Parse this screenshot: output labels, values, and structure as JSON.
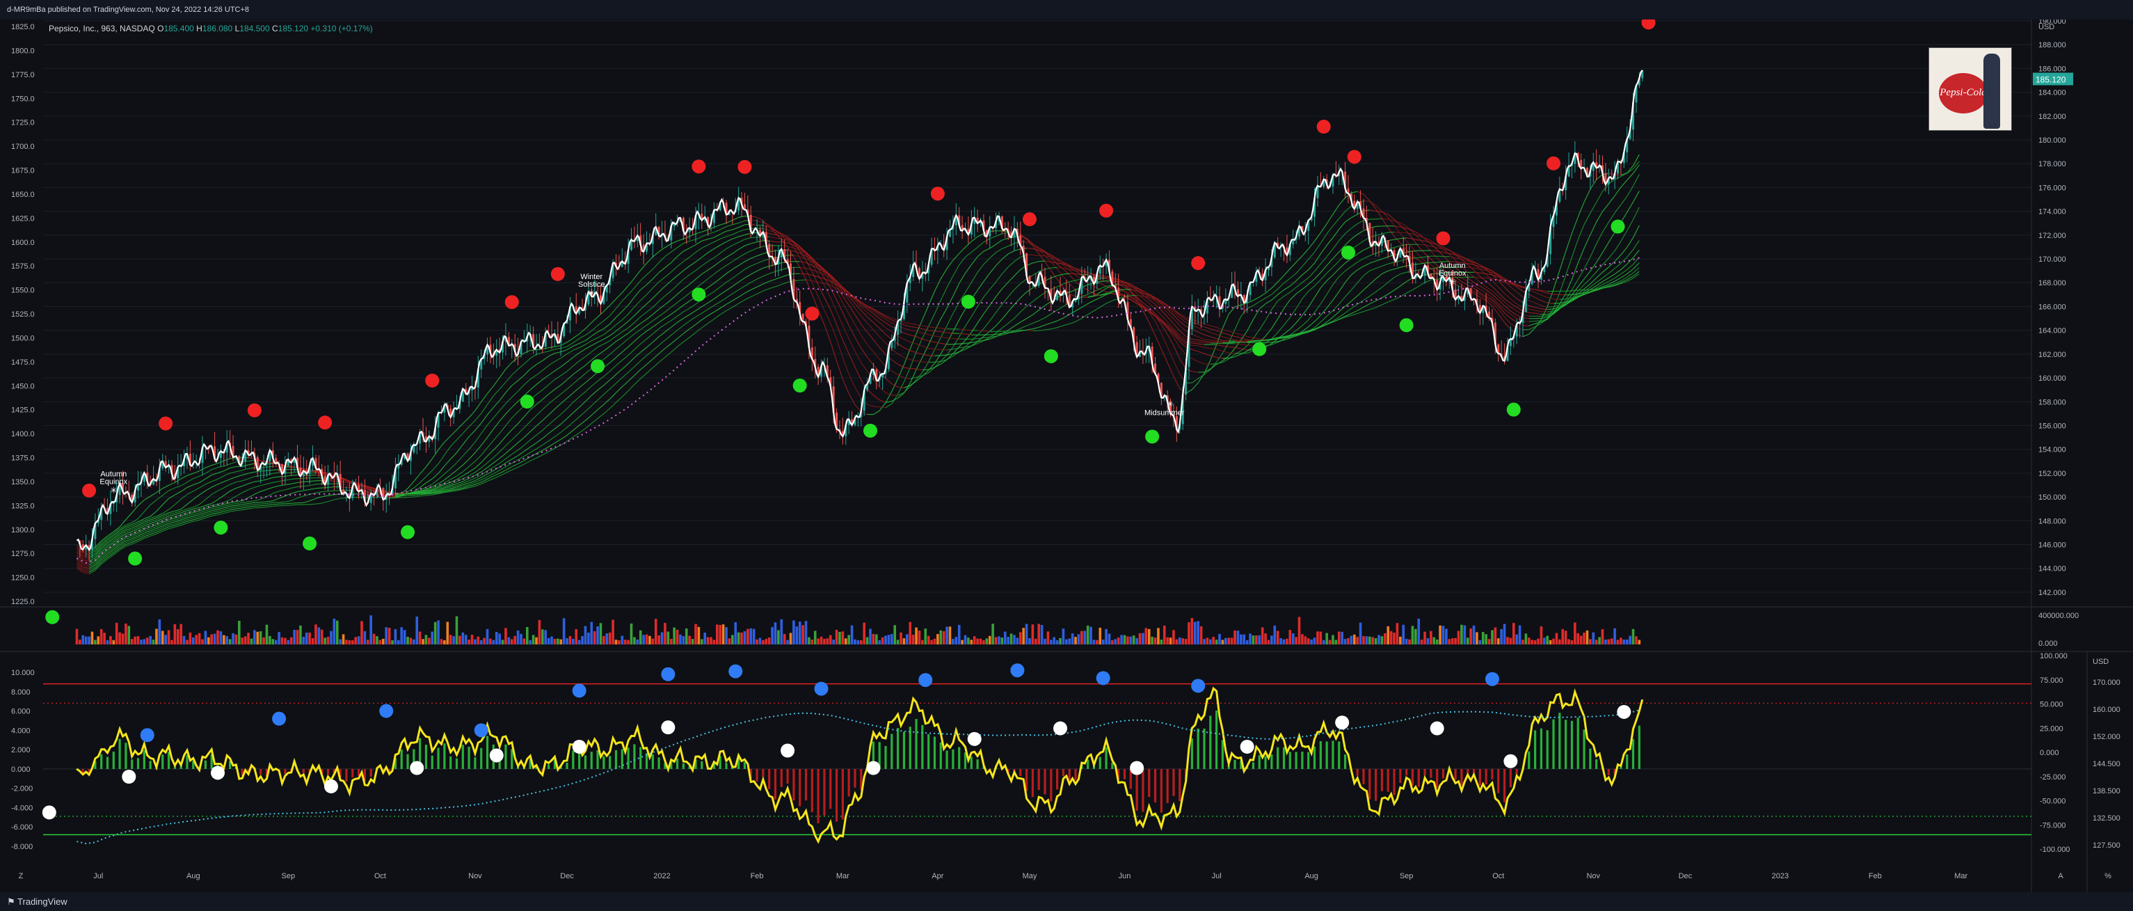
{
  "header": {
    "publisher_line": "d-MR9mBa published on TradingView.com, Nov 24, 2022 14:26 UTC+8"
  },
  "legend": {
    "symbol": "Pepsico, Inc., 963, NASDAQ",
    "open_label": "O",
    "open": "185.400",
    "high_label": "H",
    "high": "186.080",
    "low_label": "L",
    "low": "184.500",
    "close_label": "C",
    "close": "185.120",
    "change": "+0.310 (+0.17%)"
  },
  "footer": {
    "brand": "TradingView",
    "left_corner": "Z",
    "right_corner_a": "A",
    "right_corner_b": "%"
  },
  "thumbnail": {
    "logo_text": "Pepsi-Cola"
  },
  "colors": {
    "background": "#0e1015",
    "up": "#26a69a",
    "down": "#ef5350",
    "price_line": "#ffffff",
    "green_dot": "#22dd22",
    "red_dot": "#ee2222",
    "blue_dot": "#2f7cf6",
    "white_dot": "#ffffff",
    "oscillator": "#f5e51b",
    "signal_dotted": "#49c0e0",
    "ma_dotted": "#d966e0"
  },
  "chart_data": [
    {
      "type": "line",
      "title": "",
      "currency": "USD",
      "x_axis": {
        "tick_labels": [
          "Jul",
          "Aug",
          "Sep",
          "Oct",
          "Nov",
          "Dec",
          "2022",
          "Feb",
          "Mar",
          "Apr",
          "May",
          "Jun",
          "Jul",
          "Aug",
          "Sep",
          "Oct",
          "Nov",
          "Dec",
          "2023",
          "Feb",
          "Mar"
        ]
      },
      "left_axis": {
        "tick_labels": [
          "1825.0",
          "1800.0",
          "1775.0",
          "1750.0",
          "1725.0",
          "1700.0",
          "1675.0",
          "1650.0",
          "1625.0",
          "1600.0",
          "1575.0",
          "1550.0",
          "1525.0",
          "1500.0",
          "1475.0",
          "1450.0",
          "1425.0",
          "1400.0",
          "1375.0",
          "1350.0",
          "1325.0",
          "1300.0",
          "1275.0",
          "1250.0",
          "1225.0"
        ],
        "range": [
          1225,
          1825
        ]
      },
      "right_axis": {
        "unit_label": "USD",
        "tick_labels": [
          "190.000",
          "188.000",
          "186.000",
          "184.000",
          "182.000",
          "180.000",
          "178.000",
          "176.000",
          "174.000",
          "172.000",
          "170.000",
          "168.000",
          "166.000",
          "164.000",
          "162.000",
          "160.000",
          "158.000",
          "156.000",
          "154.000",
          "152.000",
          "150.000",
          "148.000",
          "146.000",
          "144.000",
          "142.000"
        ],
        "range": [
          141,
          190
        ],
        "last_price_label": "185.120"
      },
      "series": [
        {
          "name": "",
          "kind": "price",
          "x": [
            "2021-07-01",
            "2021-07-15",
            "2021-08-01",
            "2021-08-15",
            "2021-09-01",
            "2021-09-15",
            "2021-10-01",
            "2021-10-08",
            "2021-10-20",
            "2021-11-01",
            "2021-11-15",
            "2021-12-01",
            "2021-12-15",
            "2022-01-01",
            "2022-01-15",
            "2022-02-01",
            "2022-02-15",
            "2022-03-01",
            "2022-03-08",
            "2022-03-20",
            "2022-04-01",
            "2022-04-15",
            "2022-05-01",
            "2022-05-10",
            "2022-05-20",
            "2022-06-01",
            "2022-06-15",
            "2022-06-25",
            "2022-07-01",
            "2022-07-15",
            "2022-08-01",
            "2022-08-15",
            "2022-09-01",
            "2022-09-15",
            "2022-10-01",
            "2022-10-10",
            "2022-10-20",
            "2022-11-01",
            "2022-11-15",
            "2022-11-24"
          ],
          "values": [
            145.5,
            150.2,
            152.4,
            153.9,
            153.0,
            152.4,
            150.3,
            150.1,
            154.5,
            157.6,
            162.6,
            163.1,
            166.5,
            171.4,
            172.8,
            174.4,
            170.2,
            160.8,
            155.4,
            160.5,
            168.9,
            172.8,
            172.7,
            168.0,
            166.6,
            169.2,
            161.9,
            156.2,
            165.9,
            167.0,
            171.3,
            177.0,
            171.0,
            168.5,
            166.5,
            162.0,
            168.5,
            178.0,
            177.0,
            185.12
          ]
        }
      ],
      "markers": [
        {
          "date": "2021-07-13",
          "text": "Autumn Equinox"
        },
        {
          "date": "2021-12-16",
          "text": "Winter Solstice"
        },
        {
          "date": "2022-06-21",
          "text": "Midsummer"
        },
        {
          "date": "2022-09-23",
          "text": "Autumn Equinox"
        }
      ]
    },
    {
      "type": "bar",
      "title": "",
      "y_axis": {
        "tick_labels": [
          "400000.000",
          "0.000"
        ]
      }
    },
    {
      "type": "area",
      "title": "",
      "left_axis": {
        "tick_labels": [
          "10.000",
          "8.000",
          "6.000",
          "4.000",
          "2.000",
          "0.000",
          "-2.000",
          "-4.000",
          "-6.000",
          "-8.000"
        ],
        "range": [
          -8,
          10
        ],
        "levels": {
          "upper_solid": 8.8,
          "upper_dotted": 6.8,
          "lower_dotted": -4.9,
          "lower_solid": -6.8
        }
      },
      "mid_axis": {
        "tick_labels": [
          "100.000",
          "75.000",
          "50.000",
          "25.000",
          "0.000",
          "-25.000",
          "-50.000",
          "-75.000",
          "-100.000"
        ],
        "range": [
          -100,
          100
        ]
      },
      "right_axis": {
        "unit_label": "USD",
        "tick_labels": [
          "170.000",
          "160.000",
          "152.000",
          "144.500",
          "138.500",
          "132.500",
          "127.500"
        ]
      }
    }
  ]
}
